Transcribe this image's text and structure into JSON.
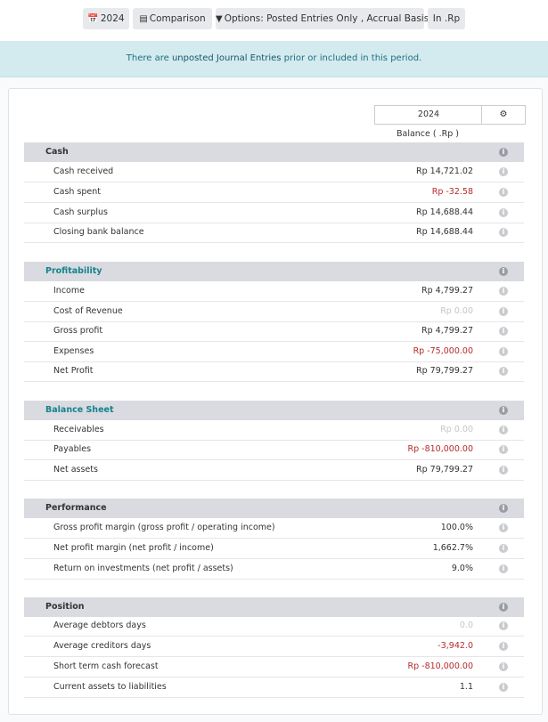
{
  "toolbar": {
    "period_label": "2024",
    "comparison_label": "Comparison",
    "options_label": "Options: Posted Entries Only , Accrual Basis",
    "currency_label": "In .Rp"
  },
  "alert": {
    "prefix": "There are ",
    "link": "unposted Journal Entries",
    "suffix": " prior or included in this period."
  },
  "table": {
    "column_year": "2024",
    "column_subheader": "Balance ( .Rp )",
    "info_glyph": "i",
    "sections": [
      {
        "title": "Cash",
        "rows": [
          {
            "label": "Cash received",
            "value": "Rp 14,721.02"
          },
          {
            "label": "Cash spent",
            "value": "Rp -32.58"
          },
          {
            "label": "Cash surplus",
            "value": "Rp 14,688.44"
          },
          {
            "label": "Closing bank balance",
            "value": "Rp 14,688.44"
          }
        ]
      },
      {
        "title": "Profitability",
        "rows": [
          {
            "label": "Income",
            "value": "Rp 4,799.27"
          },
          {
            "label": "Cost of Revenue",
            "value": "Rp 0.00"
          },
          {
            "label": "Gross profit",
            "value": "Rp 4,799.27"
          },
          {
            "label": "Expenses",
            "value": "Rp -75,000.00"
          },
          {
            "label": "Net Profit",
            "value": "Rp 79,799.27"
          }
        ]
      },
      {
        "title": "Balance Sheet",
        "rows": [
          {
            "label": "Receivables",
            "value": "Rp 0.00"
          },
          {
            "label": "Payables",
            "value": "Rp -810,000.00"
          },
          {
            "label": "Net assets",
            "value": "Rp 79,799.27"
          }
        ]
      },
      {
        "title": "Performance",
        "rows": [
          {
            "label": "Gross profit margin (gross profit / operating income)",
            "value": "100.0%"
          },
          {
            "label": "Net profit margin (net profit / income)",
            "value": "1,662.7%"
          },
          {
            "label": "Return on investments (net profit / assets)",
            "value": "9.0%"
          }
        ]
      },
      {
        "title": "Position",
        "rows": [
          {
            "label": "Average debtors days",
            "value": "0.0"
          },
          {
            "label": "Average creditors days",
            "value": "-3,942.0"
          },
          {
            "label": "Short term cash forecast",
            "value": "Rp -810,000.00"
          },
          {
            "label": "Current assets to liabilities",
            "value": "1.1"
          }
        ]
      }
    ]
  }
}
